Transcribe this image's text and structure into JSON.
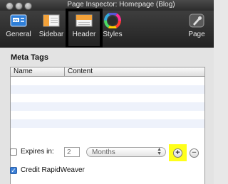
{
  "window": {
    "title": "Page Inspector: Homepage (Blog)"
  },
  "toolbar": {
    "items": [
      {
        "label": "General",
        "icon": "id-card-icon"
      },
      {
        "label": "Sidebar",
        "icon": "sidebar-icon"
      },
      {
        "label": "Header",
        "icon": "header-icon",
        "selected": true
      },
      {
        "label": "Styles",
        "icon": "color-wheel-icon"
      },
      {
        "label": "Page",
        "icon": "page-gear-icon"
      }
    ]
  },
  "meta": {
    "title": "Meta Tags",
    "columns": [
      "Name",
      "Content"
    ],
    "rows": []
  },
  "expires": {
    "label": "Expires in:",
    "checked": false,
    "value": "2",
    "unit": "Months"
  },
  "credit": {
    "label": "Credit RapidWeaver",
    "checked": true
  },
  "colors": {
    "highlight": "#ffff1a",
    "annotation_box": "#000000",
    "checkbox_accent": "#3b7fd6"
  }
}
